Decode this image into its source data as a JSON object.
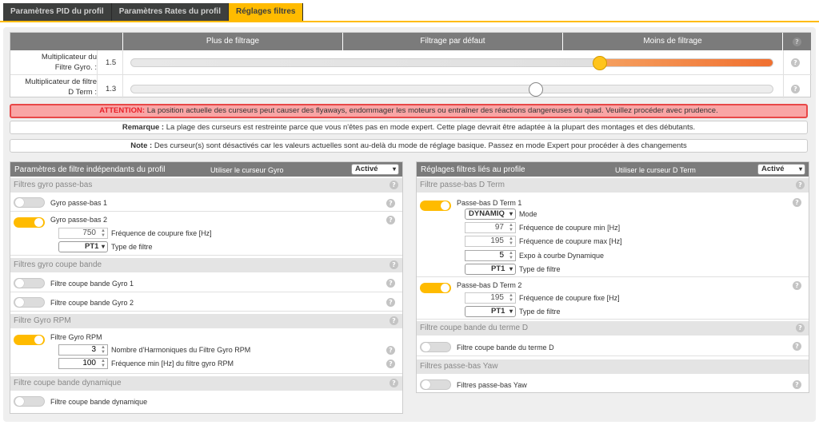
{
  "tabs": [
    {
      "label": "Paramètres PID du profil"
    },
    {
      "label": "Paramètres Rates du profil"
    },
    {
      "label": "Réglages filtres"
    }
  ],
  "slider_header": {
    "more": "Plus de filtrage",
    "default": "Filtrage par défaut",
    "less": "Moins de filtrage"
  },
  "sliders": [
    {
      "label_line1": "Multiplicateur du",
      "label_line2": "Filtre Gyro. :",
      "value": "1.5",
      "position": 0.73
    },
    {
      "label_line1": "Multiplicateur de filtre",
      "label_line2": "D Term :",
      "value": "1.3",
      "position": 0.63
    }
  ],
  "warning": {
    "prefix": "ATTENTION:",
    "text": " La position actuelle des curseurs peut causer des flyaways, endommager les moteurs ou entraîner des réactions dangereuses du quad. Veuillez procéder avec prudence."
  },
  "remark": {
    "prefix": "Remarque :",
    "text": " La plage des curseurs est restreinte parce que vous n'êtes pas en mode expert. Cette plage devrait être adaptée à la plupart des montages et des débutants."
  },
  "note": {
    "prefix": "Note :",
    "text": " Des curseur(s) sont désactivés car les valeurs actuelles sont au-delà du mode de réglage basique. Passez en mode Expert pour procéder à des changements"
  },
  "left_panel": {
    "title": "Paramètres de filtre indépendants du profil",
    "use_slider": "Utiliser le curseur Gyro",
    "select": "Activé",
    "sections": {
      "lowpass": "Filtres gyro passe-bas",
      "notch": "Filtres gyro coupe bande",
      "rpm": "Filtre Gyro RPM",
      "dyn": "Filtre coupe bande dynamique"
    },
    "gyro_lp1": "Gyro passe-bas 1",
    "gyro_lp2": "Gyro passe-bas 2",
    "gyro_lp2_cutoff_value": "750",
    "gyro_lp2_cutoff_label": "Fréquence de coupure fixe [Hz]",
    "gyro_lp2_type_value": "PT1",
    "gyro_lp2_type_label": "Type de filtre",
    "notch1": "Filtre coupe bande Gyro 1",
    "notch2": "Filtre coupe bande Gyro 2",
    "rpm_label": "Filtre Gyro RPM",
    "rpm_harmonics_value": "3",
    "rpm_harmonics_label": "Nombre d'Harmoniques du Filtre Gyro RPM",
    "rpm_minfreq_value": "100",
    "rpm_minfreq_label": "Fréquence min [Hz] du filtre gyro RPM",
    "dyn_notch": "Filtre coupe bande dynamique"
  },
  "right_panel": {
    "title": "Réglages filtres liés au profile",
    "use_slider": "Utiliser le curseur D Term",
    "select": "Activé",
    "sections": {
      "lowpass": "Filtre passe-bas D Term",
      "notch": "Filtre coupe bande du terme D",
      "yaw": "Filtres passe-bas Yaw"
    },
    "dterm_lp1": "Passe-bas D Term 1",
    "dterm_lp1_mode_value": "DYNAMIQ",
    "dterm_lp1_mode_label": "Mode",
    "dterm_lp1_min_value": "97",
    "dterm_lp1_min_label": "Fréquence de coupure min [Hz]",
    "dterm_lp1_max_value": "195",
    "dterm_lp1_max_label": "Fréquence de coupure max [Hz]",
    "dterm_lp1_expo_value": "5",
    "dterm_lp1_expo_label": "Expo à courbe Dynamique",
    "dterm_lp1_type_value": "PT1",
    "dterm_lp1_type_label": "Type de filtre",
    "dterm_lp2": "Passe-bas D Term 2",
    "dterm_lp2_cutoff_value": "195",
    "dterm_lp2_cutoff_label": "Fréquence de coupure fixe [Hz]",
    "dterm_lp2_type_value": "PT1",
    "dterm_lp2_type_label": "Type de filtre",
    "dterm_notch": "Filtre coupe bande du terme D",
    "yaw_lp": "Filtres passe-bas Yaw"
  },
  "icons": {
    "help": "?",
    "chevron": "⌄"
  },
  "colors": {
    "accent": "#ffbb00",
    "tab_bg": "#3d3f3e",
    "header_bg": "#7b7b7b",
    "warning_text": "#e8212a",
    "warning_bg": "#f9a5a5",
    "slider_orange": "#f07030"
  }
}
